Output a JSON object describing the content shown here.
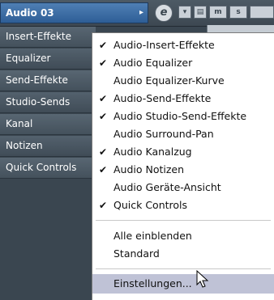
{
  "header": {
    "track_name": "Audio 03",
    "arrow_glyph": "▸",
    "edit_glyph": "e",
    "mini_buttons": [
      "▾",
      "▤",
      "m",
      "s"
    ]
  },
  "sidebar": {
    "sections": [
      "Insert-Effekte",
      "Equalizer",
      "Send-Effekte",
      "Studio-Sends",
      "Kanal",
      "Notizen",
      "Quick Controls"
    ]
  },
  "menu": {
    "group1": [
      {
        "label": "Audio-Insert-Effekte",
        "checked": true
      },
      {
        "label": "Audio Equalizer",
        "checked": true
      },
      {
        "label": "Audio Equalizer-Kurve",
        "checked": false
      },
      {
        "label": "Audio-Send-Effekte",
        "checked": true
      },
      {
        "label": "Audio Studio-Send-Effekte",
        "checked": true
      },
      {
        "label": "Audio Surround-Pan",
        "checked": false
      },
      {
        "label": "Audio Kanalzug",
        "checked": true
      },
      {
        "label": "Audio Notizen",
        "checked": true
      },
      {
        "label": "Audio Geräte-Ansicht",
        "checked": false
      },
      {
        "label": "Quick Controls",
        "checked": true
      }
    ],
    "group2": [
      {
        "label": "Alle einblenden"
      },
      {
        "label": "Standard"
      }
    ],
    "settings": {
      "label": "Einstellungen..."
    },
    "check_glyph": "✔"
  },
  "colors": {
    "track_tab": "#3b6ca5",
    "panel_bg": "#3a4650",
    "menu_highlight": "#bfc2d6"
  }
}
